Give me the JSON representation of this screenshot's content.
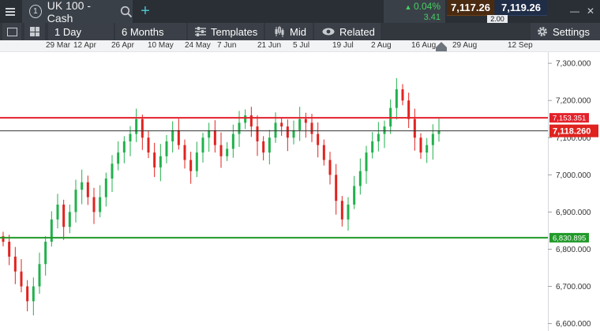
{
  "topbar": {
    "tab_number": "1",
    "instrument": "UK 100 - Cash",
    "add_label": "+",
    "change_pct": "0.04%",
    "change_abs": "3.41",
    "sell_price": "7,117.26",
    "buy_price": "7,119.26",
    "spread": "2.00",
    "minimize": "—",
    "close": "✕"
  },
  "toolbar": {
    "interval": "1 Day",
    "range": "6 Months",
    "templates": "Templates",
    "price_type": "Mid",
    "related": "Related",
    "settings": "Settings"
  },
  "colors": {
    "up": "#22b14c",
    "down": "#e0231f",
    "resistance": "#e3212b",
    "support": "#219a29"
  },
  "chart_data": {
    "type": "candlestick",
    "x_labels": [
      "29 Mar",
      "12 Apr",
      "26 Apr",
      "10 May",
      "24 May",
      "7 Jun",
      "21 Jun",
      "5 Jul",
      "19 Jul",
      "2 Aug",
      "16 Aug",
      "29 Aug",
      "12 Sep"
    ],
    "y_ticks": [
      6600,
      6700,
      6800,
      6900,
      7000,
      7100,
      7200,
      7300
    ],
    "y_tick_labels": [
      "6,600.000",
      "6,700.000",
      "6,800.000",
      "6,900.000",
      "7,000.000",
      "7,100.000",
      "7,200.000",
      "7,300.000"
    ],
    "ylim": [
      6580,
      7330
    ],
    "lines": [
      {
        "kind": "resistance",
        "value": 7153.351,
        "label": "7,153.351"
      },
      {
        "kind": "current",
        "value": 7118.26,
        "label": "7,118.260"
      },
      {
        "kind": "support",
        "value": 6830.895,
        "label": "6,830.895"
      }
    ],
    "closes": [
      6820,
      6780,
      6740,
      6700,
      6660,
      6700,
      6760,
      6820,
      6880,
      6920,
      6860,
      6900,
      6960,
      6980,
      6940,
      6900,
      6940,
      6990,
      7030,
      7060,
      7090,
      7110,
      7150,
      7100,
      7060,
      7020,
      7050,
      7090,
      7120,
      7080,
      7040,
      7010,
      7060,
      7100,
      7120,
      7080,
      7050,
      7070,
      7110,
      7140,
      7160,
      7130,
      7090,
      7060,
      7100,
      7140,
      7130,
      7100,
      7120,
      7150,
      7140,
      7110,
      7080,
      7040,
      7000,
      6930,
      6880,
      6920,
      6970,
      7010,
      7060,
      7090,
      7110,
      7130,
      7180,
      7230,
      7200,
      7150,
      7100,
      7060,
      7080,
      7110,
      7118
    ]
  }
}
